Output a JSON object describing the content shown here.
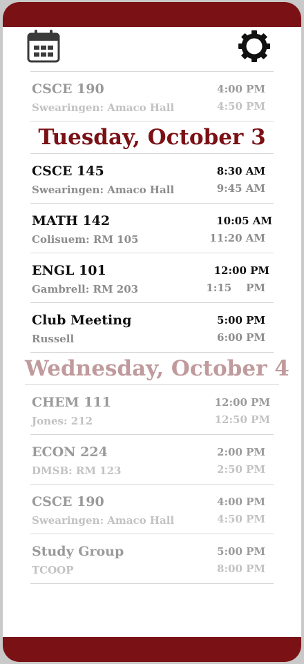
{
  "header": {
    "calendar_icon": "calendar-icon",
    "settings_icon": "gear-icon"
  },
  "colors": {
    "accent": "#7a1115",
    "faded_heading": "#c09a9c"
  },
  "schedule": {
    "prev_item": {
      "name": "CSCE 190",
      "location": "Swearingen: Amaco Hall",
      "start": "4:00 PM",
      "end": "4:50 PM"
    },
    "days": [
      {
        "title": "Tuesday, October 3",
        "items": [
          {
            "name": "CSCE 145",
            "location": "Swearingen: Amaco Hall",
            "start": "8:30 AM",
            "end": "9:45 AM"
          },
          {
            "name": "MATH 142",
            "location": "Colisuem: RM 105",
            "start": "10:05 AM",
            "end": "11:20 AM"
          },
          {
            "name": "ENGL 101",
            "location": "Gambrell: RM 203",
            "start": "12:00 PM",
            "end": "1:15    PM"
          },
          {
            "name": "Club Meeting",
            "location": "Russell",
            "start": "5:00 PM",
            "end": "6:00 PM"
          }
        ]
      },
      {
        "title": "Wednesday, October 4",
        "items": [
          {
            "name": "CHEM 111",
            "location": "Jones: 212",
            "start": "12:00 PM",
            "end": "12:50 PM"
          },
          {
            "name": "ECON 224",
            "location": "DMSB: RM 123",
            "start": "2:00 PM",
            "end": "2:50 PM"
          },
          {
            "name": "CSCE 190",
            "location": "Swearingen: Amaco Hall",
            "start": "4:00 PM",
            "end": "4:50 PM"
          },
          {
            "name": "Study Group",
            "location": "TCOOP",
            "start": "5:00 PM",
            "end": "8:00 PM"
          }
        ]
      }
    ]
  }
}
